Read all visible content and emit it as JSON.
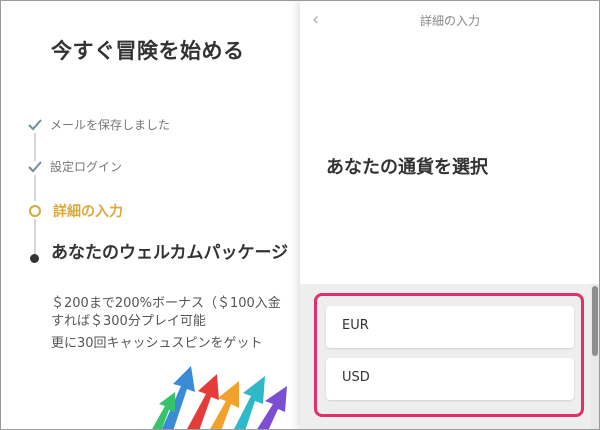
{
  "left": {
    "title": "今すぐ冒険を始める",
    "steps": [
      {
        "label": "メールを保存しました",
        "state": "done"
      },
      {
        "label": "設定ログイン",
        "state": "done"
      },
      {
        "label": "詳細の入力",
        "state": "active"
      }
    ],
    "welcome": {
      "title": "あなたのウェルカムパッケージ",
      "bonus": "＄200まで200%ボーナス（＄100入金すれば＄300分プレイ可能",
      "spins": "更に30回キャッシュスピンをゲット"
    }
  },
  "right": {
    "header_title": "詳細の入力",
    "heading": "あなたの通貨を選択",
    "options": [
      "EUR",
      "USD"
    ]
  },
  "colors": {
    "accent": "#d9a93a",
    "highlight": "#e0306b",
    "text": "#333333"
  }
}
